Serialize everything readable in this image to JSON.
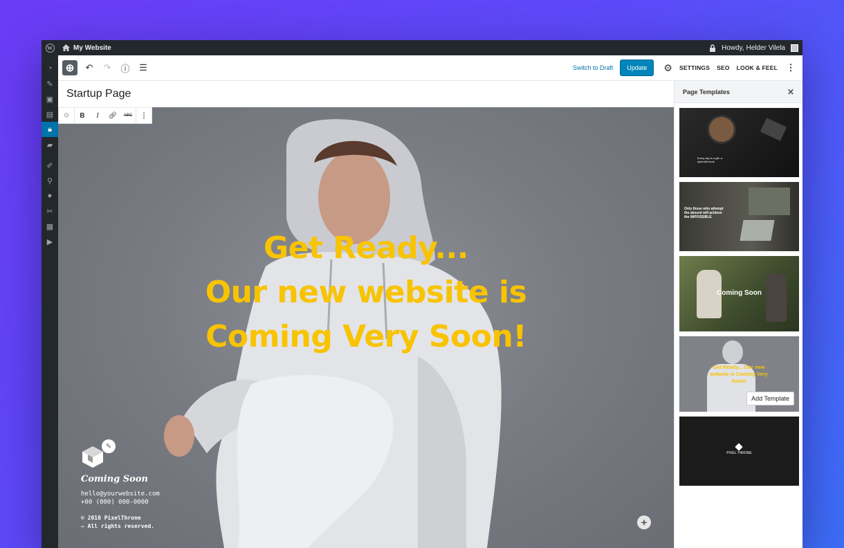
{
  "adminbar": {
    "site_name": "My Website",
    "greeting": "Howdy, Helder Vilela"
  },
  "toolbar": {
    "switch_to_draft": "Switch to Draft",
    "update": "Update",
    "settings": "SETTINGS",
    "seo": "SEO",
    "look_and_feel": "LOOK & FEEL"
  },
  "editor": {
    "page_title": "Startup Page",
    "headline": [
      "Get Ready...",
      "Our new website is",
      "Coming Very Soon!"
    ],
    "footer": {
      "title": "Coming Soon",
      "email": "hello@yourwebsite.com",
      "phone": "+00 (000) 000-0000",
      "copyright_line1": "© 2018 PixelThrone",
      "copyright_line2": "— All rights reserved."
    }
  },
  "panel": {
    "title": "Page Templates",
    "add_template": "Add Template",
    "thumbnails": [
      {
        "text": "Every day is a gift, a splendid book"
      },
      {
        "text": "Only those who attempt the absurd will achieve the IMPOSSIBLE"
      },
      {
        "text": "Coming Soon"
      },
      {
        "text": "Get Ready... Our new website is Coming Very Soon!"
      },
      {
        "text": "PIXEL THRONE"
      }
    ]
  },
  "colors": {
    "accent_yellow": "#f8c300",
    "wp_blue": "#0073aa",
    "admin_dark": "#23282d"
  }
}
